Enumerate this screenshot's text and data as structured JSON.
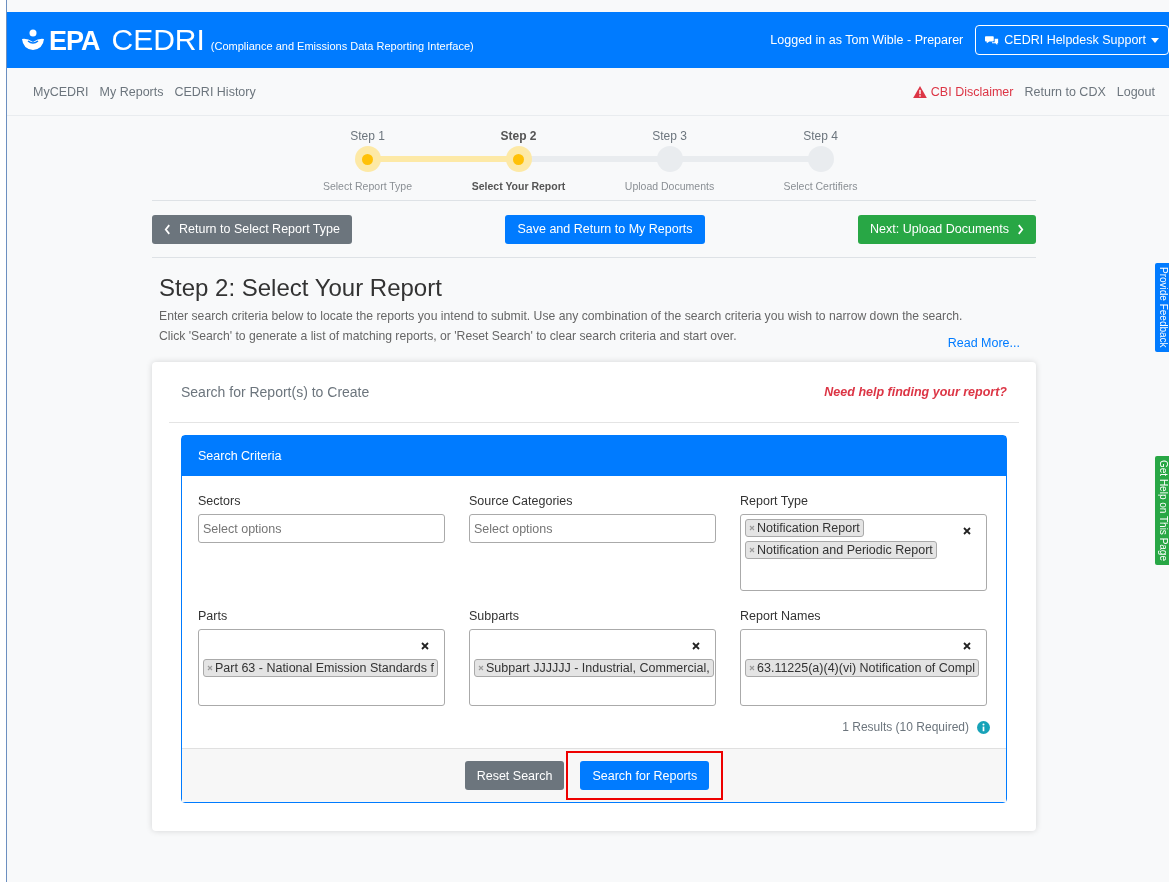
{
  "header": {
    "logo": "EPA",
    "app_name": "CEDRI",
    "subtitle": "(Compliance and Emissions Data Reporting Interface)",
    "user": "Logged in as Tom Wible - Preparer",
    "helpdesk_button": "CEDRI Helpdesk Support"
  },
  "nav": {
    "left": [
      "MyCEDRI",
      "My Reports",
      "CEDRI History"
    ],
    "disclaimer": "CBI Disclaimer",
    "right": [
      "Return to CDX",
      "Logout"
    ]
  },
  "steps": [
    {
      "step": "Step 1",
      "label": "Select Report Type",
      "completed": true,
      "selected": false
    },
    {
      "step": "Step 2",
      "label": "Select Your Report",
      "completed": false,
      "selected": true
    },
    {
      "step": "Step 3",
      "label": "Upload Documents",
      "completed": false,
      "selected": false
    },
    {
      "step": "Step 4",
      "label": "Select Certifiers",
      "completed": false,
      "selected": false
    }
  ],
  "actions": {
    "back": "Return to Select Report Type",
    "save": "Save and Return to My Reports",
    "next": "Next: Upload Documents"
  },
  "title": "Step 2: Select Your Report",
  "intro": [
    "Enter search criteria below to locate the reports you intend to submit. Use any combination of the search criteria you wish to narrow down the search.",
    "Click 'Search' to generate a list of matching reports, or 'Reset Search' to clear search criteria and start over."
  ],
  "read_more": "Read More...",
  "card": {
    "title": "Search for Report(s) to Create",
    "help_link": "Need help finding your report?"
  },
  "criteria": {
    "title": "Search Criteria",
    "fields": [
      {
        "label": "Sectors",
        "placeholder": "Select options"
      },
      {
        "label": "Source Categories",
        "placeholder": "Select options"
      },
      {
        "label": "Report Type",
        "chips": [
          "Notification Report",
          "Notification and Periodic Report"
        ]
      },
      {
        "label": "Parts",
        "chips": [
          "Part 63 - National Emission Standards f"
        ]
      },
      {
        "label": "Subparts",
        "chips": [
          "Subpart JJJJJJ - Industrial, Commercial,"
        ]
      },
      {
        "label": "Report Names",
        "chips": [
          "63.11225(a)(4)(vi) Notification of Compl"
        ]
      }
    ],
    "results": "1 Results (10 Required)",
    "reset": "Reset Search",
    "search": "Search for Reports"
  },
  "side_tabs": [
    {
      "label": "Provide Feedback",
      "color": "#007bff"
    },
    {
      "label": "Get Help on This Page",
      "color": "#28a745"
    }
  ]
}
